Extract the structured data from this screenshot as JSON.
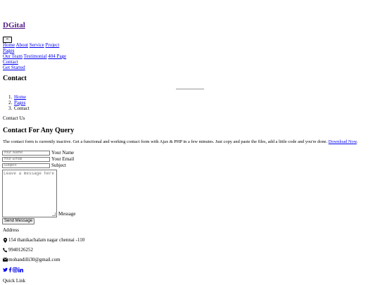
{
  "brand": "DGital",
  "menu_toggle": "≡",
  "nav": {
    "home": "Home",
    "about": "About",
    "service": "Service",
    "project": "Project",
    "pages": "Pages",
    "our_team": "Our Team",
    "testimonial": "Testimonial",
    "page_404": "404 Page",
    "contact": "Contact",
    "get_started": "Get Started"
  },
  "page_title": "Contact",
  "breadcrumb": {
    "items": [
      {
        "num": "1.",
        "label": "Home"
      },
      {
        "num": "2.",
        "label": "Pages"
      },
      {
        "num": "3.",
        "label": "Contact"
      }
    ]
  },
  "section_sub": "Contact Us",
  "section_title": "Contact For Any Query",
  "description": "The contact form is currently inactive. Get a functional and working contact form with Ajax & PHP in a few minutes. Just copy and paste the files, add a little code and you're done.",
  "download_link": "Download Now",
  "form": {
    "name_placeholder": "Your Name",
    "name_label": "Your Name",
    "email_placeholder": "Your Email",
    "email_label": "Your Email",
    "subject_placeholder": "Subject",
    "subject_label": "Subject",
    "message_placeholder": "Leave a message here",
    "message_label": "Message",
    "submit": "Send Message"
  },
  "footer": {
    "address_heading": "Address",
    "address": "154 thanikachalam nagar chennai -110",
    "phone": "9940126252",
    "email": "mohandilli30@gmail.com",
    "quick_link_heading": "Quick Link",
    "icons": [
      "map-marker-icon",
      "phone-icon",
      "envelope-icon",
      "twitter-icon",
      "facebook-icon",
      "instagram-icon",
      "linkedin-icon"
    ]
  },
  "colors": {
    "link": "#0000ee",
    "visited": "#551a8b"
  }
}
